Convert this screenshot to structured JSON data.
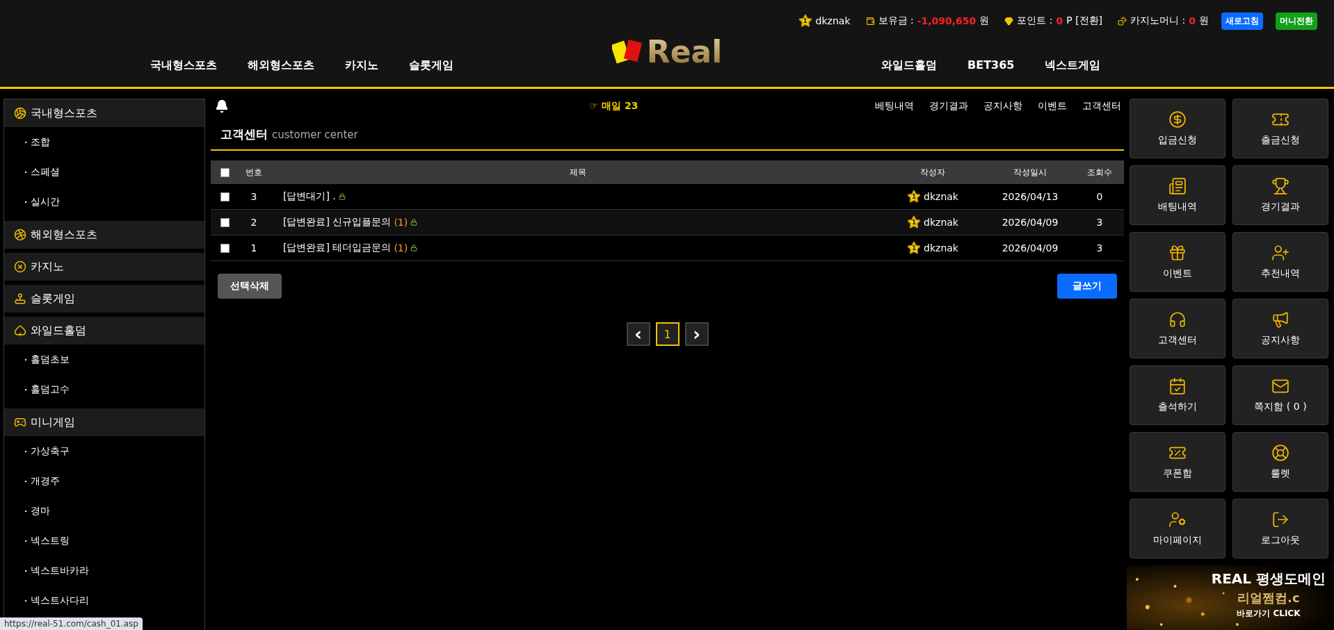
{
  "header": {
    "user": {
      "badge": "1",
      "name": "dkznak"
    },
    "balance": {
      "label": "보유금 :",
      "value": "-1,090,650",
      "unit": "원"
    },
    "points": {
      "label": "포인트 :",
      "value": "0",
      "unit": "P [전환]"
    },
    "casino_money": {
      "label": "카지노머니 :",
      "value": "0",
      "unit": "원"
    },
    "buttons": [
      {
        "label": "새로고침",
        "color": "#0a6cff"
      },
      {
        "label": "머니전환",
        "color": "#12a01a"
      }
    ],
    "logo": "Real",
    "nav_left": [
      "국내형스포츠",
      "해외형스포츠",
      "카지노",
      "슬롯게임"
    ],
    "nav_right": [
      "와일드홀덤",
      "BET365",
      "넥스트게임"
    ]
  },
  "sidebar": [
    {
      "label": "국내형스포츠",
      "children": [
        "조합",
        "스페셜",
        "실시간"
      ]
    },
    {
      "label": "해외형스포츠"
    },
    {
      "label": "카지노"
    },
    {
      "label": "슬롯게임"
    },
    {
      "label": "와일드홀덤",
      "children": [
        "홀덤초보",
        "홀덤고수"
      ]
    },
    {
      "label": "미니게임",
      "children": [
        "가상축구",
        "개경주",
        "경마",
        "넥스트링",
        "넥스트바카라",
        "넥스트사다리"
      ]
    }
  ],
  "top_bar": {
    "marquee": "☞ 매일 23",
    "links": [
      "베팅내역",
      "경기결과",
      "공지사항",
      "이벤트",
      "고객센터"
    ]
  },
  "page_title": {
    "title": "고객센터",
    "subtitle": "customer center"
  },
  "table": {
    "columns": [
      "번호",
      "제목",
      "작성자",
      "작성일시",
      "조회수"
    ],
    "header_checked": false,
    "rows": [
      {
        "checked": false,
        "number": "3",
        "title": "[답변대기] .",
        "reply_count": "",
        "locked": true,
        "badge": "1",
        "author": "dkznak",
        "date": "2026/04/13",
        "views": "0"
      },
      {
        "checked": false,
        "number": "2",
        "title": "[답변완료] 신규입플문의",
        "reply_count": "(1)",
        "locked": true,
        "badge": "1",
        "author": "dkznak",
        "date": "2026/04/09",
        "views": "3"
      },
      {
        "checked": false,
        "number": "1",
        "title": "[답변완료] 테더입금문의",
        "reply_count": "(1)",
        "locked": true,
        "badge": "1",
        "author": "dkznak",
        "date": "2026/04/09",
        "views": "3"
      }
    ]
  },
  "actions": {
    "delete": "선택삭제",
    "write": "글쓰기"
  },
  "pagination": {
    "prev": "‹",
    "next": "›",
    "pages": [
      {
        "label": "1",
        "selected": true
      }
    ]
  },
  "quick_menu": [
    "입금신청",
    "출금신청",
    "배팅내역",
    "경기결과",
    "이벤트",
    "추천내역",
    "고객센터",
    "공지사항",
    "출석하기",
    "쪽지함 ( 0 )",
    "쿠폰함",
    "룰렛",
    "마이페이지",
    "로그아웃"
  ],
  "banner": {
    "kind": "picture",
    "title": "REAL 평생도메인",
    "domain": "리얼쩜컴.c",
    "cta": "바로가기 CLICK"
  },
  "status_bar": "https://real-51.com/cash_01.asp"
}
